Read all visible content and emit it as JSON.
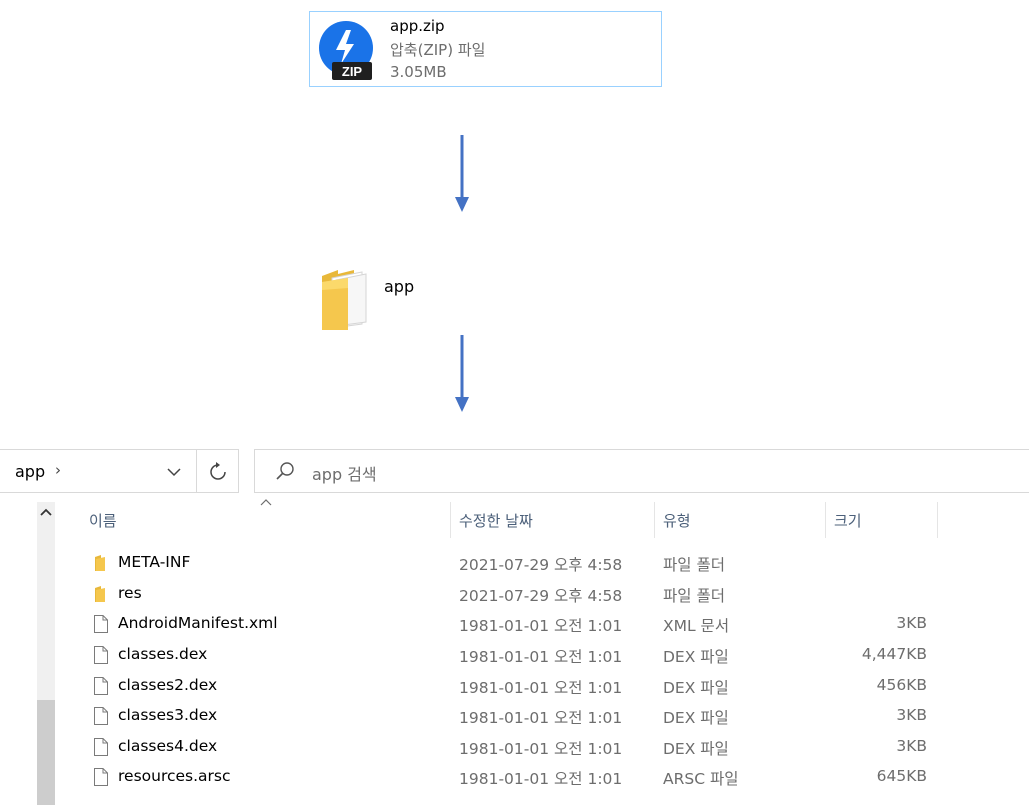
{
  "zip": {
    "name": "app.zip",
    "type": "압축(ZIP) 파일",
    "size": "3.05MB",
    "icon_text": "ZIP"
  },
  "folder": {
    "name": "app"
  },
  "address": {
    "path": "app",
    "separator": "›"
  },
  "search": {
    "placeholder": "app 검색"
  },
  "columns": {
    "name": "이름",
    "date": "수정한 날짜",
    "type": "유형",
    "size": "크기"
  },
  "files": [
    {
      "name": "META-INF",
      "date": "2021-07-29 오후 4:58",
      "type": "파일 폴더",
      "size": "",
      "icon": "folder-icon"
    },
    {
      "name": "res",
      "date": "2021-07-29 오후 4:58",
      "type": "파일 폴더",
      "size": "",
      "icon": "folder-icon"
    },
    {
      "name": "AndroidManifest.xml",
      "date": "1981-01-01 오전 1:01",
      "type": "XML 문서",
      "size": "3KB",
      "icon": "file-icon"
    },
    {
      "name": "classes.dex",
      "date": "1981-01-01 오전 1:01",
      "type": "DEX 파일",
      "size": "4,447KB",
      "icon": "file-icon"
    },
    {
      "name": "classes2.dex",
      "date": "1981-01-01 오전 1:01",
      "type": "DEX 파일",
      "size": "456KB",
      "icon": "file-icon"
    },
    {
      "name": "classes3.dex",
      "date": "1981-01-01 오전 1:01",
      "type": "DEX 파일",
      "size": "3KB",
      "icon": "file-icon"
    },
    {
      "name": "classes4.dex",
      "date": "1981-01-01 오전 1:01",
      "type": "DEX 파일",
      "size": "3KB",
      "icon": "file-icon"
    },
    {
      "name": "resources.arsc",
      "date": "1981-01-01 오전 1:01",
      "type": "ARSC 파일",
      "size": "645KB",
      "icon": "file-icon"
    }
  ],
  "colors": {
    "accent": "#4472c4",
    "selection_border": "#99d1ff",
    "folder": "#f5c74d"
  }
}
